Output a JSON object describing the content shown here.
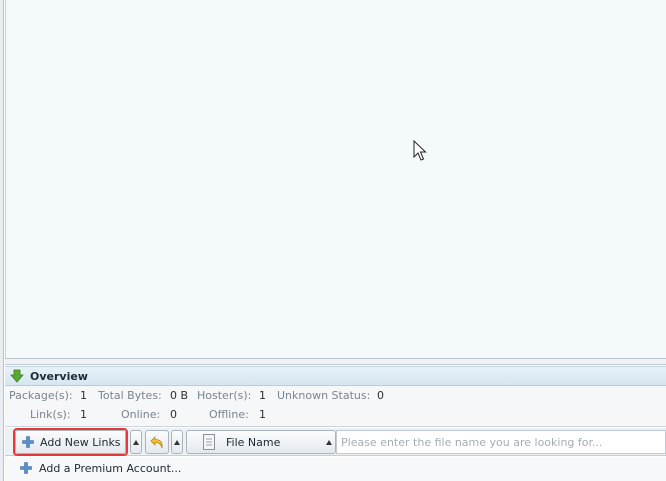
{
  "overview": {
    "title": "Overview",
    "row1": [
      {
        "label": "Package(s):",
        "value": "1"
      },
      {
        "label": "Total Bytes:",
        "value": "0 B"
      },
      {
        "label": "Hoster(s):",
        "value": "1"
      },
      {
        "label": "Unknown Status:",
        "value": "0"
      }
    ],
    "row2": [
      {
        "label": "Link(s):",
        "value": "1"
      },
      {
        "label": "Online:",
        "value": "0"
      },
      {
        "label": "Offline:",
        "value": "1"
      }
    ]
  },
  "toolbar": {
    "add_links_label": "Add New Links",
    "search_column": "File Name",
    "search_placeholder": "Please enter the file name you are looking for..."
  },
  "bottom": {
    "premium_label": "Add a Premium Account..."
  },
  "icons": {
    "overview": "download-arrow-icon",
    "add": "plus-icon",
    "undo": "undo-icon",
    "file": "file-icon",
    "cursor": "mouse-pointer-icon"
  },
  "colors": {
    "highlight": "#e23a3a",
    "list_background": "#f4f9fc",
    "plus_icon": "#5b8fc7",
    "download_icon": "#5aa832"
  }
}
